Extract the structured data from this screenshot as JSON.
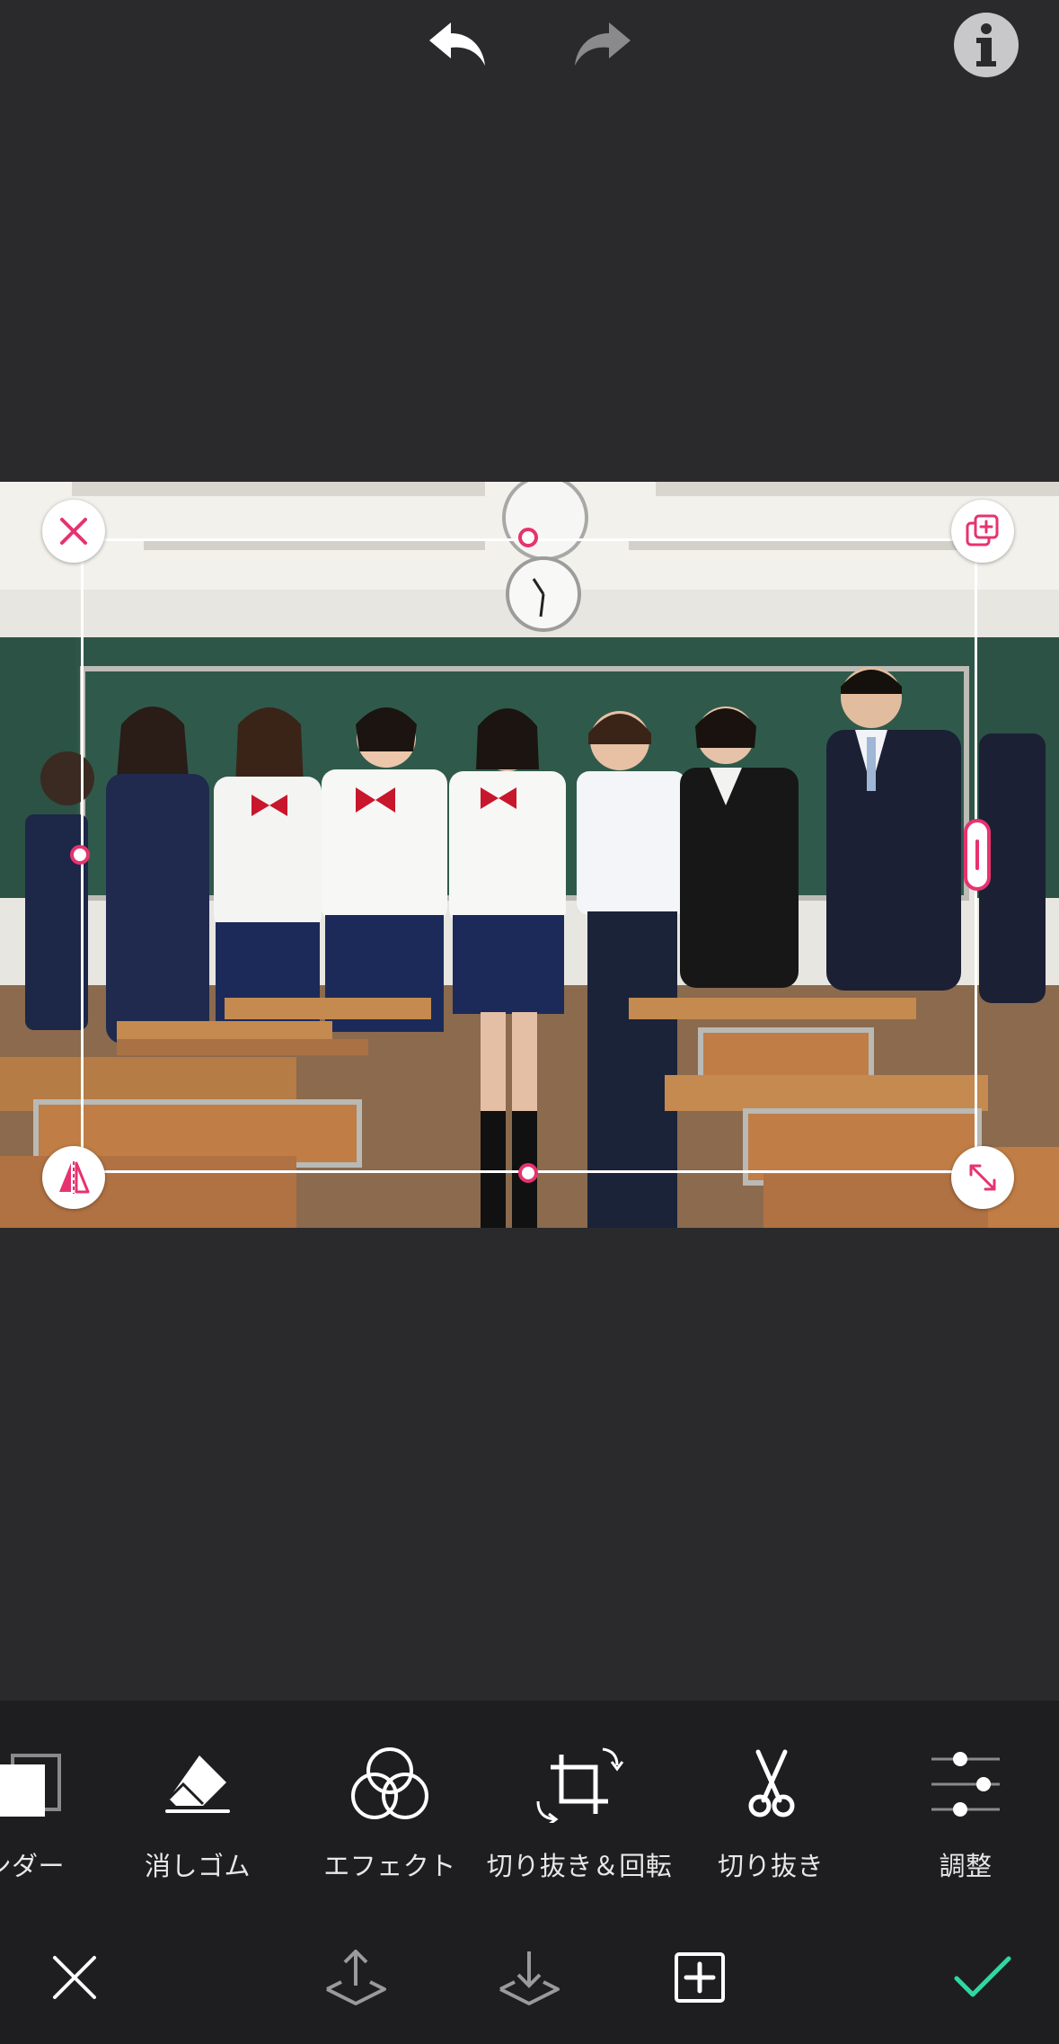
{
  "toolbar": {
    "undo_icon": "undo-arrow-icon",
    "redo_icon": "redo-arrow-icon",
    "info_icon": "info-icon"
  },
  "tools": [
    {
      "label": "ンダー",
      "icon": "blend-layers-icon"
    },
    {
      "label": "消しゴム",
      "icon": "eraser-icon"
    },
    {
      "label": "エフェクト",
      "icon": "effects-circles-icon"
    },
    {
      "label": "切り抜き＆回転",
      "icon": "crop-rotate-icon"
    },
    {
      "label": "切り抜き",
      "icon": "scissors-icon"
    },
    {
      "label": "調整",
      "icon": "sliders-icon"
    }
  ],
  "actions": {
    "cancel_icon": "close-icon",
    "bring_forward_icon": "move-up-icon",
    "send_backward_icon": "move-down-icon",
    "add_icon": "add-square-icon",
    "confirm_icon": "check-icon"
  },
  "colors": {
    "background": "#2a2a2c",
    "toolbar_bg": "#1e1e20",
    "accent_pink": "#e6336f",
    "confirm_green": "#2fd8a0"
  }
}
